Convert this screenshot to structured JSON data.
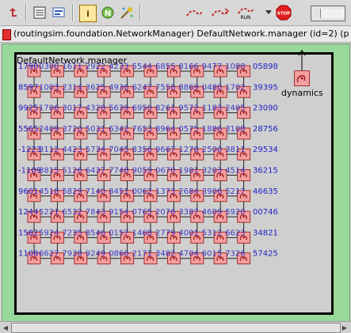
{
  "toolbar": {
    "tools": [
      {
        "icon": "up-arrow-icon"
      },
      {
        "icon": "list-icon"
      },
      {
        "icon": "inspector-icon"
      },
      {
        "icon": "info-icon",
        "glyph": "i"
      },
      {
        "icon": "netedit-icon",
        "glyph": "N"
      },
      {
        "icon": "tools-icon"
      },
      {
        "icon": "step-icon"
      },
      {
        "icon": "run-fast-icon"
      },
      {
        "icon": "run-icon",
        "label": "RUN"
      },
      {
        "icon": "dropdown-icon"
      },
      {
        "icon": "stop-icon",
        "label": "STOP"
      },
      {
        "icon": "progress-box-icon"
      }
    ],
    "stop_color": "#e02020"
  },
  "path_text": "(routingsim.foundation.NetworkManager) DefaultNetwork.manager  (id=2)  (p",
  "network_label": "DefaultNetwork.manager",
  "dynamics_label": "dynamics",
  "number_rows": [
    "1790",
    "8597",
    "9925",
    "5565",
    "-1223",
    "-1109",
    "9601",
    "1244",
    "1582",
    "1108"
  ],
  "right_numbers": [
    "05898",
    "39395",
    "23090",
    "28756",
    "29534",
    "36215",
    "46635",
    "00746",
    "34821",
    "57425"
  ],
  "colors": {
    "accent": "#2020c8",
    "module_fill": "#f4a0a0",
    "module_border": "#a03030",
    "canvas_bg": "#98d898"
  }
}
